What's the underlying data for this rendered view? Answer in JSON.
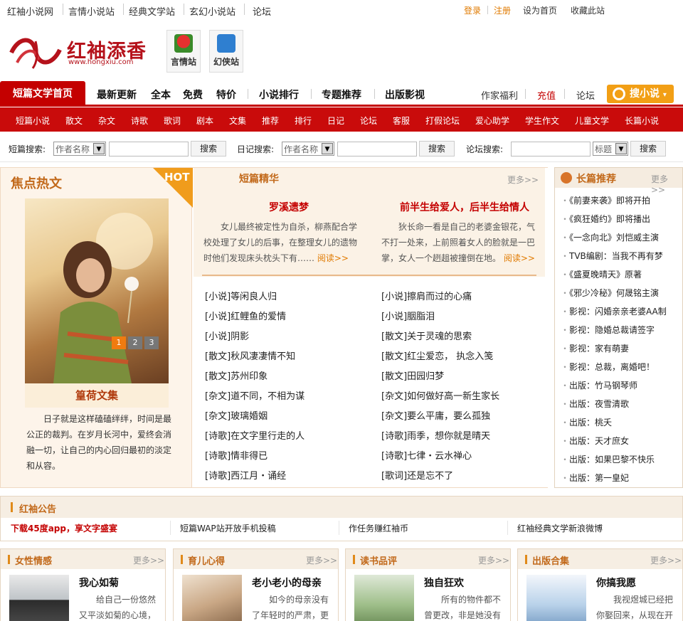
{
  "topbar": {
    "sites": [
      "红袖小说网",
      "言情小说站",
      "经典文学站",
      "玄幻小说站",
      "论坛"
    ],
    "login": "登录",
    "register": "注册",
    "set_home": "设为首页",
    "favorite": "收藏此站"
  },
  "logo": {
    "brand": "红袖添香",
    "url": "www.hongxiu.com"
  },
  "subsites": [
    {
      "label": "言情站",
      "icon": "rose-icon"
    },
    {
      "label": "幻侠站",
      "icon": "sword-icon"
    }
  ],
  "mainnav": {
    "home": "短篇文学首页",
    "items": [
      "最新更新",
      "全本",
      "免费",
      "特价",
      "小说排行",
      "专题推荐",
      "出版影视"
    ],
    "right": [
      "作家福利",
      "充值",
      "论坛"
    ],
    "search_button": "搜小说"
  },
  "subnav": [
    "短篇小说",
    "散文",
    "杂文",
    "诗歌",
    "歌词",
    "剧本",
    "文集",
    "推荐",
    "排行",
    "日记",
    "论坛",
    "客服",
    "打假论坛",
    "爱心助学",
    "学生作文",
    "儿童文学",
    "长篇小说"
  ],
  "search": {
    "short_label": "短篇搜索:",
    "short_select": "作者名称",
    "diary_label": "日记搜索:",
    "diary_select": "作者名称",
    "forum_label": "论坛搜索:",
    "forum_select": "标题",
    "button": "搜索"
  },
  "focus": {
    "title": "焦点热文",
    "hot": "HOT",
    "pages": [
      "1",
      "2",
      "3"
    ],
    "caption": "篁荷文集",
    "desc": "日子就是这样磕磕绊绊，时间是最公正的裁判。在岁月长河中，爱终会消融一切，让自己的内心回归最初的淡定和从容。"
  },
  "middle": {
    "title": "短篇精华",
    "more": "更多>>",
    "featured": [
      {
        "title": "罗溪遗梦",
        "desc": "女儿最终被定性为自杀，柳燕配合学校处理了女儿的后事，在整理女儿的遗物时他们发现床头枕头下有……",
        "read": "阅读>>"
      },
      {
        "title": "前半生给爱人，后半生给情人",
        "desc": "狄长命一看是自己的老婆金银花，气不打一处来，上前照着女人的脸就是一巴掌，女人一个趔趄被撞倒在地。",
        "read": "阅读>>"
      }
    ],
    "left_list": [
      "[小说]等闲良人归",
      "[小说]红鲤鱼的爱情",
      "[小说]阴影",
      "[散文]秋风凄凄情不知",
      "[散文]苏州印象",
      "[杂文]道不同，不相为谋",
      "[杂文]玻璃婚姻",
      "[诗歌]在文字里行走的人",
      "[诗歌]情非得已",
      "[诗歌]西江月・诵经"
    ],
    "right_list": [
      "[小说]擦肩而过的心痛",
      "[小说]胭脂泪",
      "[散文]关于灵魂的思索",
      "[散文]红尘爱恋，  执念入笺",
      "[散文]田园归梦",
      "[杂文]如何做好高一新生家长",
      "[杂文]要么平庸，要么孤独",
      "[诗歌]雨季，想你就是晴天",
      "[诗歌]七律・云水禅心",
      "[歌词]还是忘不了"
    ]
  },
  "right": {
    "title": "长篇推荐",
    "more": "更多>>",
    "items": [
      "《前妻来袭》即将开拍",
      "《疯狂婚约》即将播出",
      "《一念向北》刘恺威主演",
      "TVB编剧：当我不再有梦",
      "《盛夏晚晴天》原著",
      "《邪少冷秘》何晟铭主演",
      "影视：闪婚亲亲老婆AA制",
      "影视：隐婚总裁请签字",
      "影视：家有萌妻",
      "影视：总裁，离婚吧！",
      "出版：竹马钢琴师",
      "出版：夜雪清歌",
      "出版：桃夭",
      "出版：天才庶女",
      "出版：如果巴黎不快乐",
      "出版：第一皇妃"
    ]
  },
  "notice": {
    "title": "红袖公告",
    "items": [
      "下载45度app，享文字盛宴",
      "短篇WAP站开放手机投稿",
      "作任务赚红袖币",
      "红袖经典文学新浪微博"
    ]
  },
  "columns": [
    {
      "title": "女性情感",
      "more": "更多>>",
      "book": "我心如菊",
      "desc": "给自己一份悠然又平淡如菊的心境，"
    },
    {
      "title": "育儿心得",
      "more": "更多>>",
      "book": "老小老小的母亲",
      "desc": "如今的母亲没有了年轻时的严肃，更"
    },
    {
      "title": "读书品评",
      "more": "更多>>",
      "book": "独自狂欢",
      "desc": "所有的物件都不曾更改，非是她没有"
    },
    {
      "title": "出版合集",
      "more": "更多>>",
      "book": "你搞我愿",
      "desc": "我视煜城已经把你娶回来，从现在开"
    }
  ],
  "colors": {
    "brand_red": "#c40000",
    "accent_orange": "#f29f15",
    "heading_brown": "#c2691a"
  }
}
